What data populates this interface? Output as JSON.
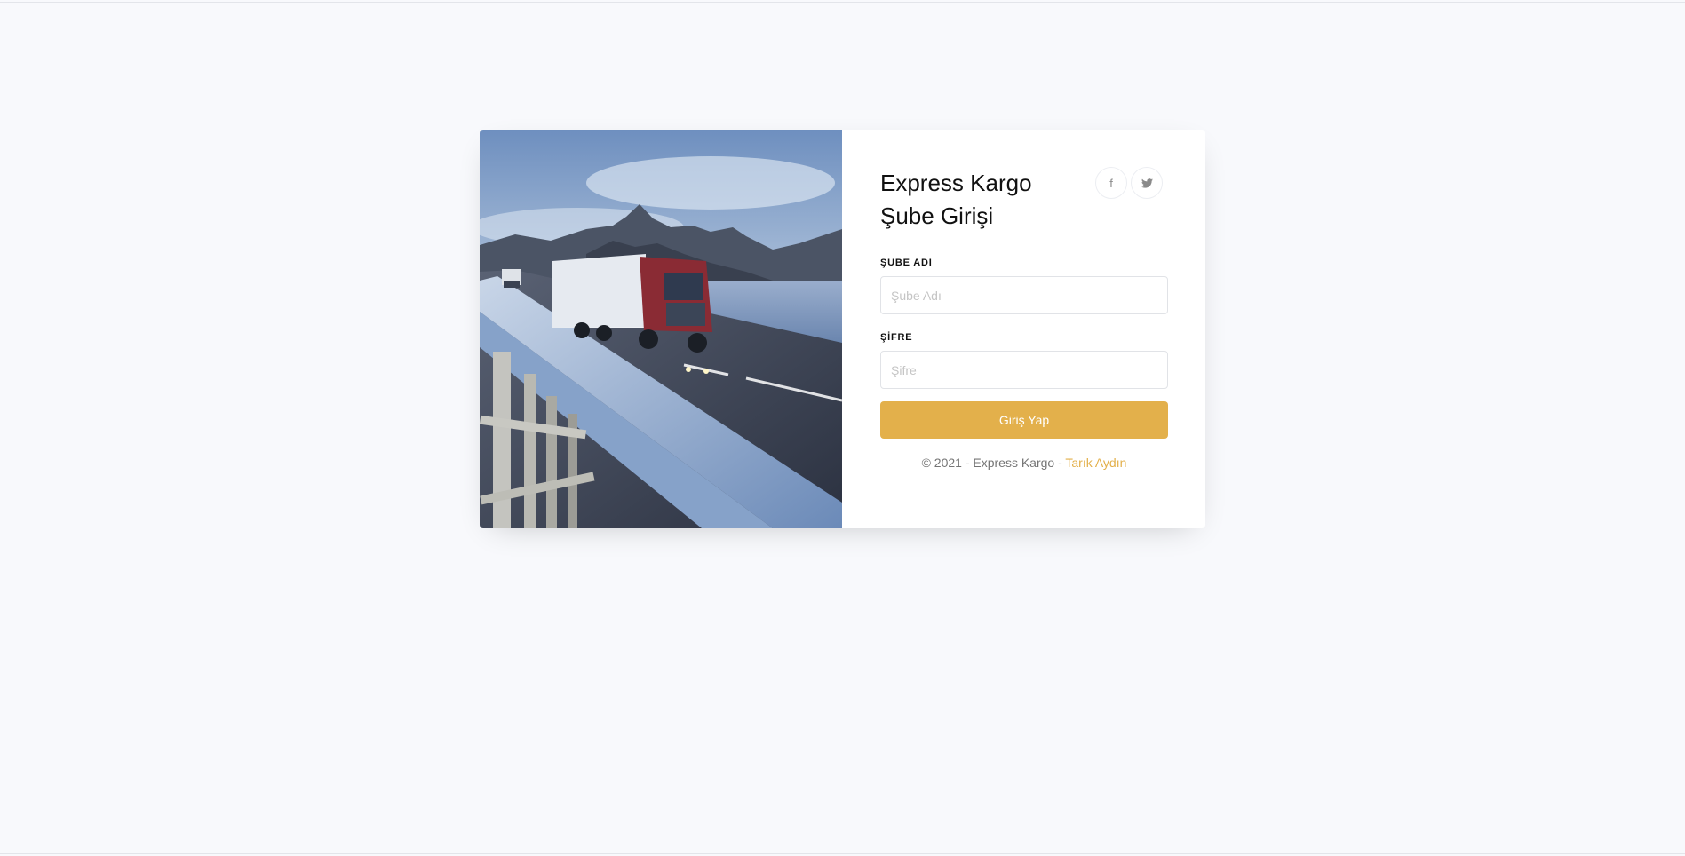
{
  "login": {
    "title_line1": "Express Kargo",
    "title_line2": "Şube Girişi",
    "branch_label": "ŞUBE ADI",
    "branch_placeholder": "Şube Adı",
    "password_label": "ŞİFRE",
    "password_placeholder": "Şifre",
    "submit_label": "Giriş Yap",
    "footer_prefix": "© 2021 - Express Kargo - ",
    "footer_author": "Tarık Aydın"
  },
  "socials": [
    {
      "icon": "facebook-icon",
      "glyph": "f"
    },
    {
      "icon": "twitter-icon",
      "glyph": "t"
    }
  ],
  "colors": {
    "accent": "#e3b04b",
    "page_background": "#f8f9fc",
    "card_background": "#ffffff",
    "title": "#111111",
    "muted_text": "#757575"
  },
  "image": {
    "subject": "truck-on-bridge-photo"
  }
}
